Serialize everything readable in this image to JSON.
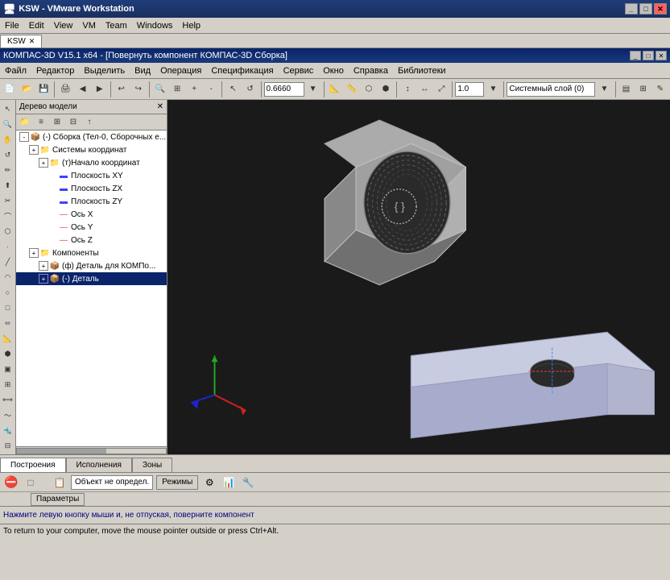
{
  "titlebar": {
    "title": "KSW - VMware Workstation",
    "controls": [
      "_",
      "□",
      "✕"
    ]
  },
  "menubar": {
    "items": [
      "File",
      "Edit",
      "View",
      "VM",
      "Team",
      "Windows",
      "Help"
    ]
  },
  "tabs": [
    {
      "label": "KSW",
      "active": true
    }
  ],
  "innertitle": {
    "text": "КОМПАС-3D V15.1 x64 - [Повернуть компонент КОМПАС-3D Сборка]",
    "controls": [
      "_",
      "□",
      "✕"
    ]
  },
  "innermenu": {
    "items": [
      "Файл",
      "Редактор",
      "Выделить",
      "Вид",
      "Операция",
      "Спецификация",
      "Сервис",
      "Окно",
      "Справка",
      "Библиотеки"
    ]
  },
  "toolbar1": {
    "zoom_value": "0.6660",
    "scale_value": "1.0",
    "layer_value": "Системный слой (0)"
  },
  "tree": {
    "header": "Дерево модели",
    "nodes": [
      {
        "label": "(-) Сборка (Тел-0, Сборочных е...",
        "indent": 0,
        "expand": "-",
        "icon": "📦"
      },
      {
        "label": "Системы координат",
        "indent": 1,
        "expand": "+",
        "icon": "📁"
      },
      {
        "label": "(т)Начало координат",
        "indent": 2,
        "expand": "+",
        "icon": "📁"
      },
      {
        "label": "Плоскость XY",
        "indent": 3,
        "expand": null,
        "icon": "▬"
      },
      {
        "label": "Плоскость ZX",
        "indent": 3,
        "expand": null,
        "icon": "▬"
      },
      {
        "label": "Плоскость ZY",
        "indent": 3,
        "expand": null,
        "icon": "▬"
      },
      {
        "label": "Ось X",
        "indent": 3,
        "expand": null,
        "icon": "📍"
      },
      {
        "label": "Ось Y",
        "indent": 3,
        "expand": null,
        "icon": "📍"
      },
      {
        "label": "Ось Z",
        "indent": 3,
        "expand": null,
        "icon": "📍"
      },
      {
        "label": "Компоненты",
        "indent": 1,
        "expand": "+",
        "icon": "📁"
      },
      {
        "label": "(ф) Деталь для КОМПо...",
        "indent": 2,
        "expand": "+",
        "icon": "📦"
      },
      {
        "label": "(-) Деталь",
        "indent": 2,
        "expand": "+",
        "icon": "📦",
        "selected": true
      }
    ]
  },
  "statustabs": {
    "tabs": [
      "Построения",
      "Исполнения",
      "Зоны"
    ]
  },
  "statusbar": {
    "object_label": "Объект не определ.",
    "mode_label": "Режимы"
  },
  "params": {
    "label": "Параметры"
  },
  "infobar": {
    "text": "Нажмите левую кнопку мыши и, не отпуская, поверните компонент"
  },
  "tooltip": {
    "text": "To return to your computer, move the mouse pointer outside or press Ctrl+Alt."
  }
}
